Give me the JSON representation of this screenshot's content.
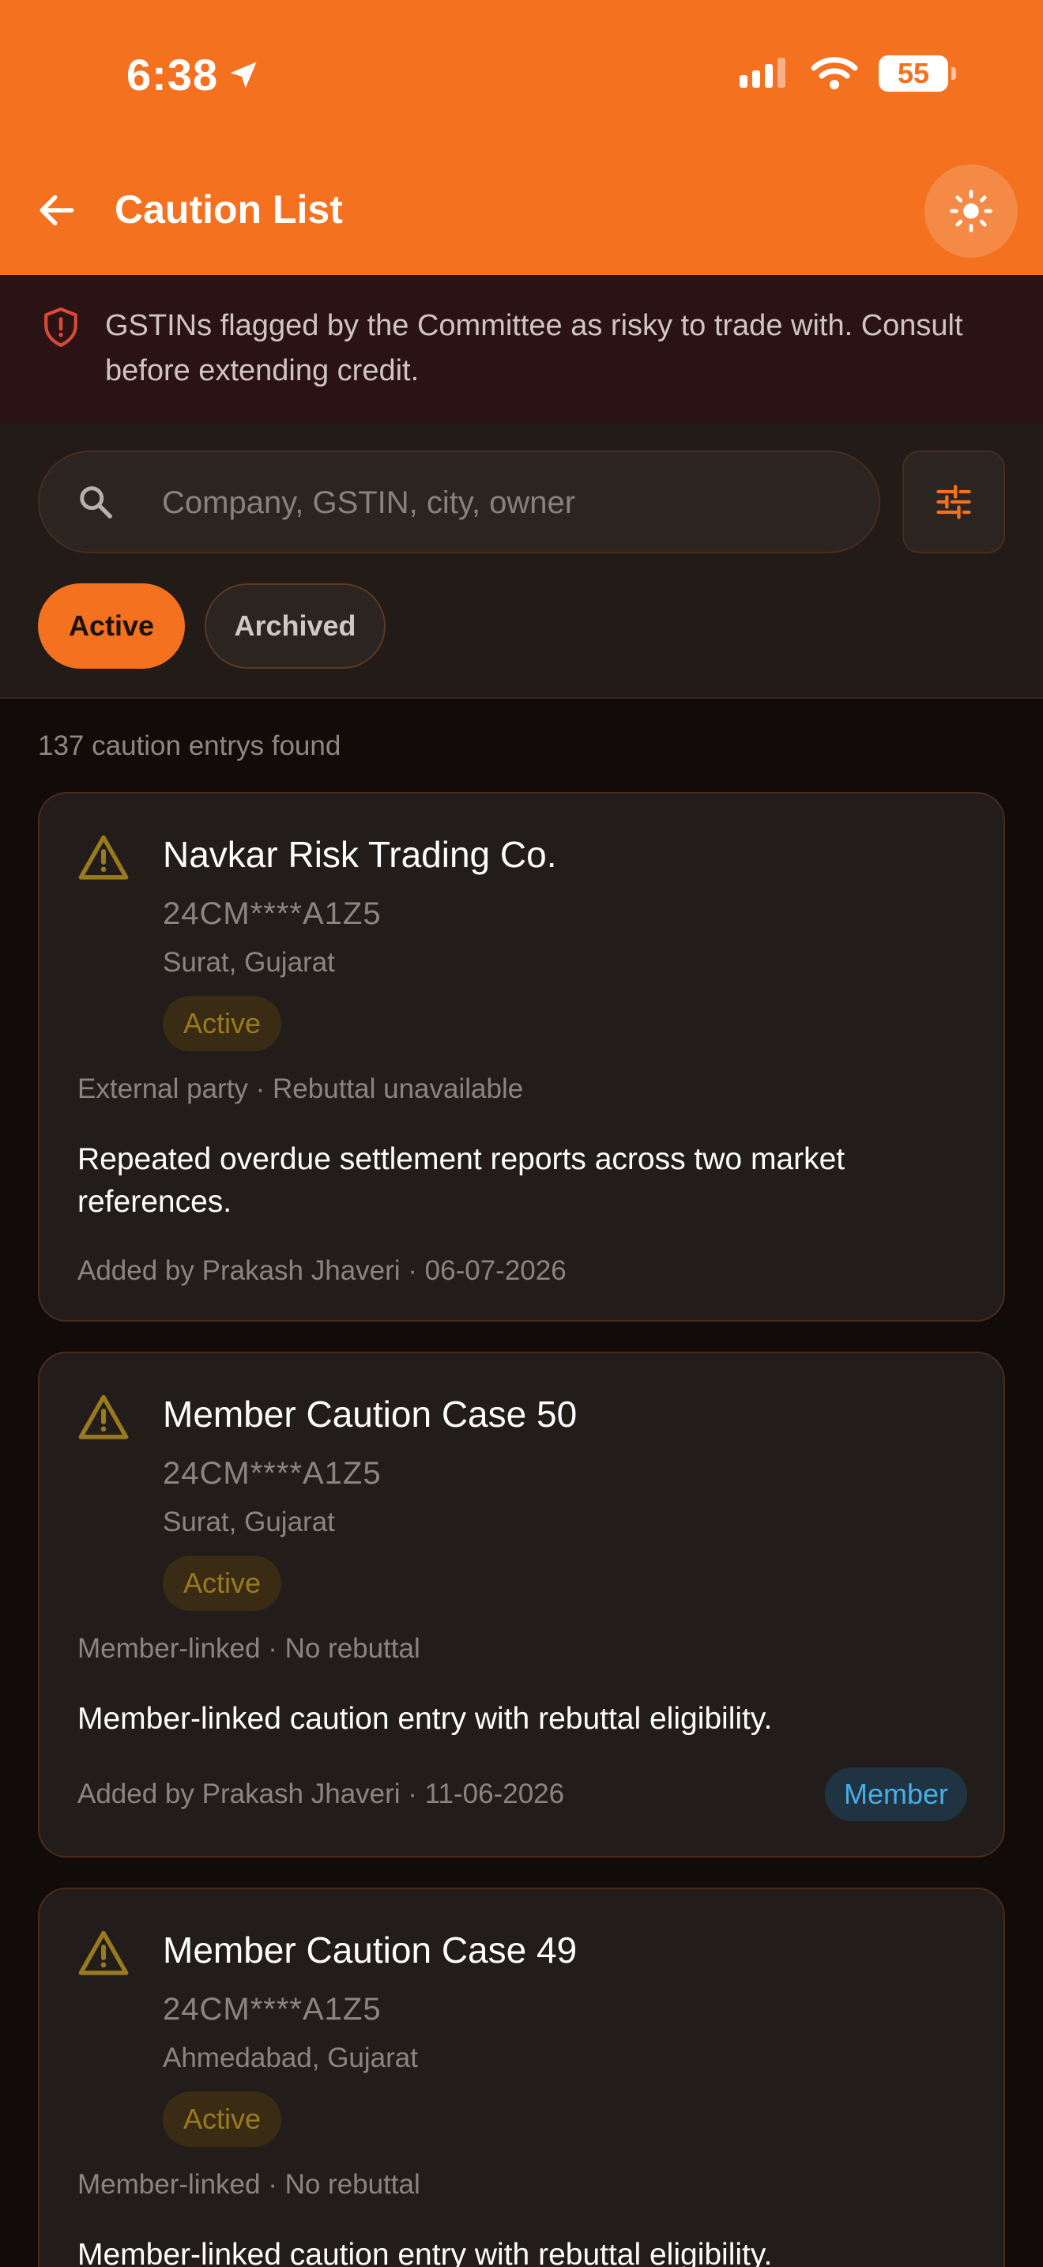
{
  "status_bar": {
    "time": "6:38",
    "battery": "55"
  },
  "header": {
    "title": "Caution List"
  },
  "banner": {
    "text": "GSTINs flagged by the Committee as risky to trade with. Consult before extending credit."
  },
  "search": {
    "placeholder": "Company, GSTIN, city, owner",
    "value": ""
  },
  "chips": {
    "active": "Active",
    "archived": "Archived"
  },
  "results": {
    "count_text": "137 caution entrys found"
  },
  "cards": [
    {
      "title": "Navkar Risk Trading Co.",
      "gstin": "24CM****A1Z5",
      "location": "Surat, Gujarat",
      "status": "Active",
      "meta": "External party · Rebuttal unavailable",
      "description": "Repeated overdue settlement reports across two market references.",
      "added": "Added by Prakash Jhaveri · 06-07-2026"
    },
    {
      "title": "Member Caution Case 50",
      "gstin": "24CM****A1Z5",
      "location": "Surat, Gujarat",
      "status": "Active",
      "meta": "Member-linked · No rebuttal",
      "description": "Member-linked caution entry with rebuttal eligibility.",
      "added": "Added by Prakash Jhaveri · 11-06-2026",
      "badge": "Member"
    },
    {
      "title": "Member Caution Case 49",
      "gstin": "24CM****A1Z5",
      "location": "Ahmedabad, Gujarat",
      "status": "Active",
      "meta": "Member-linked · No rebuttal",
      "description": "Member-linked caution entry with rebuttal eligibility."
    }
  ],
  "colors": {
    "accent": "#f3711f",
    "warning": "#9a7a1f",
    "danger": "#d94a3a",
    "member": "#49aee4"
  }
}
